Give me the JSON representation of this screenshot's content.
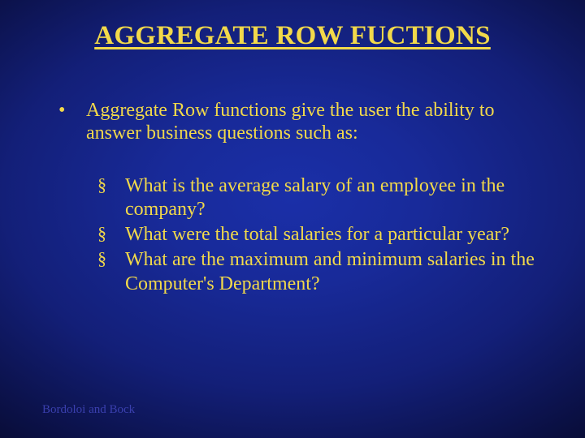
{
  "title": "AGGREGATE ROW FUCTIONS",
  "intro": "Aggregate Row functions give the user the ability to answer business questions such as:",
  "sub": [
    "What is the average salary of  an employee in the company?",
    "What were the total salaries for a particular year?",
    "What are the maximum and minimum salaries in the Computer's Department?"
  ],
  "footer": "Bordoloi and Bock"
}
